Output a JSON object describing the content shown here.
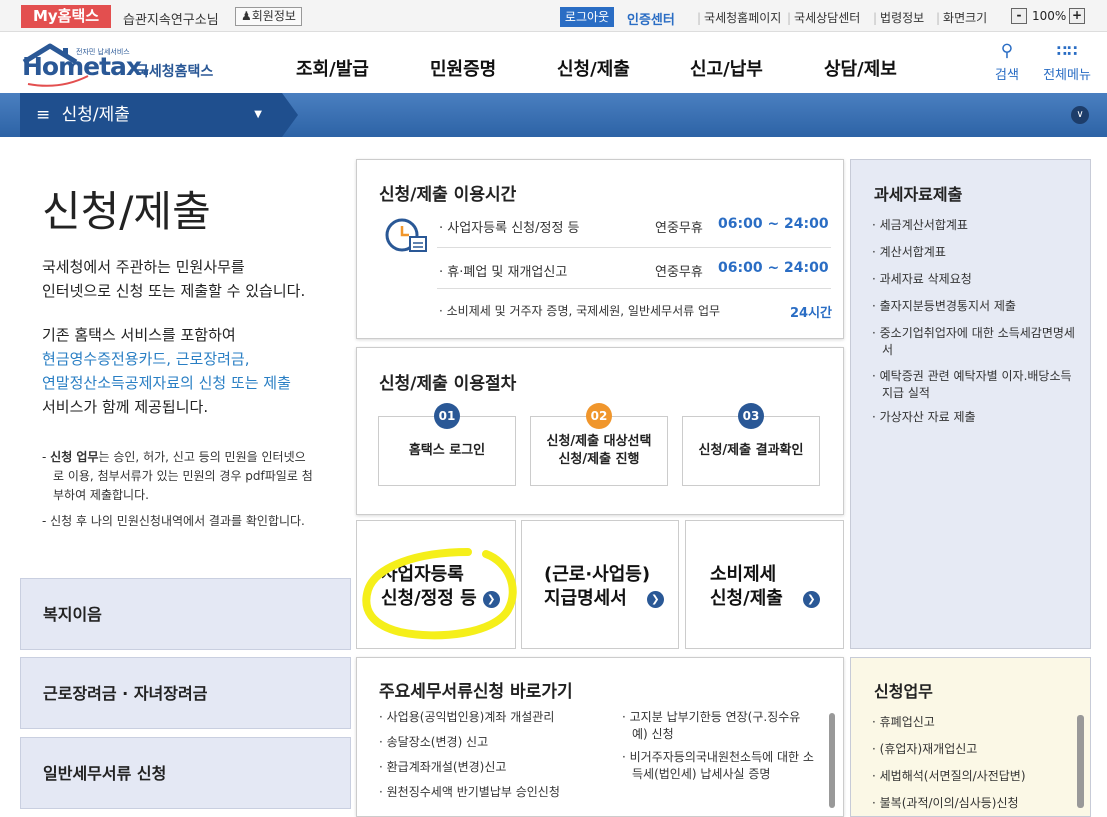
{
  "topbar": {
    "my_hometax": "My홈택스",
    "user": "습관지속연구소님",
    "member_info": "회원정보",
    "logout": "로그아웃",
    "cert_center": "인증센터",
    "links": [
      "국세청홈페이지",
      "국세상담센터",
      "법령정보",
      "화면크기"
    ],
    "zoom_minus": "-",
    "zoom": "100%",
    "zoom_plus": "+"
  },
  "header": {
    "logo_small": "전자민 납세서비스",
    "logo_main": "Hometax.",
    "logo_sub": "국세청홈택스",
    "menu": [
      "조회/발급",
      "민원증명",
      "신청/제출",
      "신고/납부",
      "상담/제보"
    ],
    "search": "검색",
    "all_menu": "전체메뉴"
  },
  "subnav": {
    "current": "신청/제출"
  },
  "intro": {
    "title": "신청/제출",
    "p1_line1": "국세청에서 주관하는 민원사무를",
    "p1_line2": "인터넷으로 신청 또는 제출할 수 있습니다.",
    "p2_line1": "기존 홈택스 서비스를 포함하여",
    "p2_line2": "현금영수증전용카드, 근로장려금,",
    "p2_line3": "연말정산소득공제자료의 신청 또는 제출",
    "p2_line4": "서비스가 함께 제공됩니다.",
    "note1_bold": "신청 업무",
    "note1_line1": "는 승인, 허가, 신고 등의 민원을 인터넷으",
    "note1_line2": "로 이용, 첨부서류가 있는 민원의 경우 pdf파일로 첨",
    "note1_line3": "부하여 제출합니다.",
    "note2": "- 신청 후 나의 민원신청내역에서 결과를 확인합니다."
  },
  "left_boxes": [
    "복지이음",
    "근로장려금 · 자녀장려금",
    "일반세무서류 신청"
  ],
  "hours": {
    "title": "신청/제출 이용시간",
    "rows": [
      {
        "label": "사업자등록 신청/정정 등",
        "prefix": "연중무휴",
        "time": "06:00 ~ 24:00"
      },
      {
        "label": "휴·폐업 및 재개업신고",
        "prefix": "연중무휴",
        "time": "06:00 ~ 24:00"
      },
      {
        "label": "소비제세 및 거주자 증명, 국제세원, 일반세무서류 업무",
        "prefix": "",
        "time": "24시간"
      }
    ]
  },
  "process": {
    "title": "신청/제출 이용절차",
    "steps": [
      {
        "num": "01",
        "line1": "홈택스 로그인",
        "line2": "",
        "color": "#2a5896"
      },
      {
        "num": "02",
        "line1": "신청/제출 대상선택",
        "line2": "신청/제출 진행",
        "color": "#f0962c"
      },
      {
        "num": "03",
        "line1": "신청/제출 결과확인",
        "line2": "",
        "color": "#2a5896"
      }
    ]
  },
  "quick": [
    {
      "line1": "사업자등록",
      "line2": "신청/정정 등"
    },
    {
      "line1": "(근로·사업등)",
      "line2": "지급명세서"
    },
    {
      "line1": "소비제세",
      "line2": "신청/제출"
    }
  ],
  "shortcuts": {
    "title": "주요세무서류신청 바로가기",
    "col1": [
      "사업용(공익법인용)계좌 개설관리",
      "송달장소(변경) 신고",
      "환급계좌개설(변경)신고",
      "원천징수세액 반기별납부 승인신청"
    ],
    "col2": [
      "고지분 납부기한등 연장(구.징수유예) 신청",
      "비거주자등의국내원천소득에 대한 소득세(법인세) 납세사실 증명"
    ]
  },
  "tax_data": {
    "title": "과세자료제출",
    "items": [
      "세금계산서합계표",
      "계산서합계표",
      "과세자료 삭제요청",
      "출자지분등변경통지서 제출",
      "중소기업취업자에 대한 소득세감면명세서",
      "예탁증권 관련 예탁자별 이자.배당소득 지급 실적",
      "가상자산 자료 제출"
    ]
  },
  "apply_work": {
    "title": "신청업무",
    "items": [
      "휴폐업신고",
      "(휴업자)재개업신고",
      "세법해석(서면질의/사전답변)",
      "불복(과적/이의/심사등)신청"
    ]
  },
  "colors": {
    "brand_blue": "#2a5896",
    "highlight_yellow": "#f5ef1a",
    "my_red": "#e34f4f"
  }
}
